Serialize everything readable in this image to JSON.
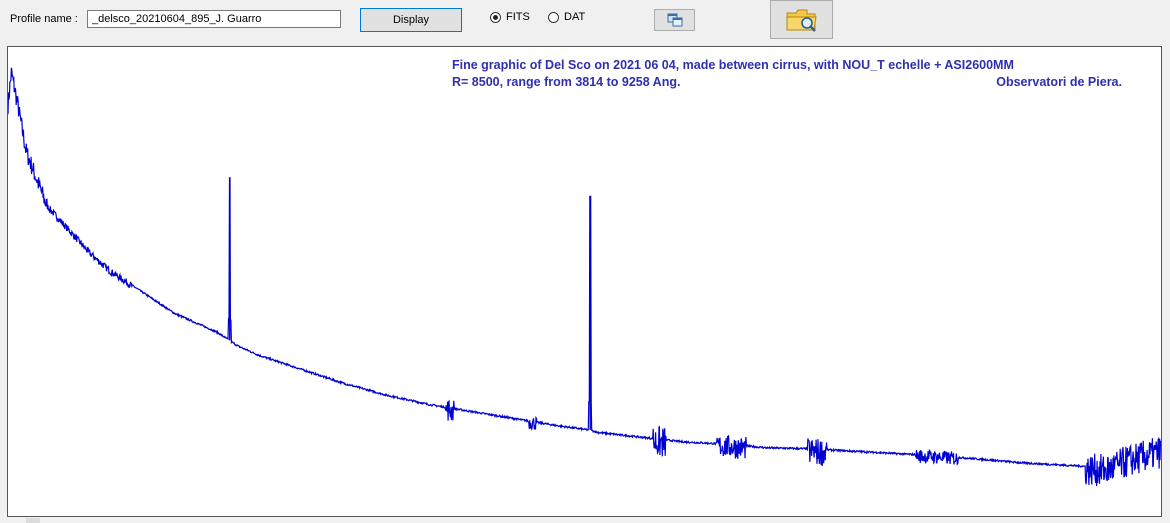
{
  "toolbar": {
    "profile_label": "Profile name :",
    "profile_value": "_delsco_20210604_895_J. Guarro",
    "display_label": "Display",
    "format_options": [
      {
        "label": "FITS",
        "selected": true
      },
      {
        "label": "DAT",
        "selected": false
      }
    ],
    "copy_icon": "copy-windows-icon",
    "folder_icon": "folder-search-icon"
  },
  "plot": {
    "caption_line1": "Fine graphic of Del Sco on  2021 06 04, made between cirrus, with NOU_T echelle + ASI2600MM",
    "caption_line2_left": "R= 8500, range from 3814 to 9258 Ang.",
    "caption_line2_right": "Observatori de Piera.",
    "line_color": "#0000d0",
    "text_color": "#2f2fb0"
  },
  "chart_data": {
    "type": "line",
    "title": "Fine graphic of Del Sco on  2021 06 04, made between cirrus, with NOU_T echelle + ASI2600MM",
    "xlabel": "",
    "ylabel": "",
    "xlim": [
      3814,
      9258
    ],
    "grid": false,
    "series": [
      {
        "x": [
          3814,
          3830,
          3860,
          3900,
          3950,
          4000,
          4100,
          4200,
          4300,
          4400,
          4500,
          4600,
          4700,
          4800,
          4900,
          5000,
          5200,
          5400,
          5600,
          5800,
          6000,
          6200,
          6400,
          6563,
          6600,
          6800,
          7000,
          7200,
          7400,
          7600,
          7800,
          8000,
          8200,
          8400,
          8600,
          8800,
          9000,
          9100,
          9258
        ],
        "y": [
          0.88,
          0.95,
          0.88,
          0.78,
          0.72,
          0.66,
          0.61,
          0.56,
          0.52,
          0.49,
          0.46,
          0.43,
          0.41,
          0.39,
          0.36,
          0.34,
          0.31,
          0.28,
          0.255,
          0.235,
          0.22,
          0.205,
          0.19,
          0.18,
          0.175,
          0.165,
          0.155,
          0.15,
          0.142,
          0.14,
          0.135,
          0.13,
          0.125,
          0.118,
          0.11,
          0.105,
          0.1,
          0.12,
          0.14
        ]
      }
    ],
    "emission_lines": [
      {
        "x": 4861,
        "y": 0.72
      },
      {
        "x": 6563,
        "y": 0.68
      }
    ]
  }
}
